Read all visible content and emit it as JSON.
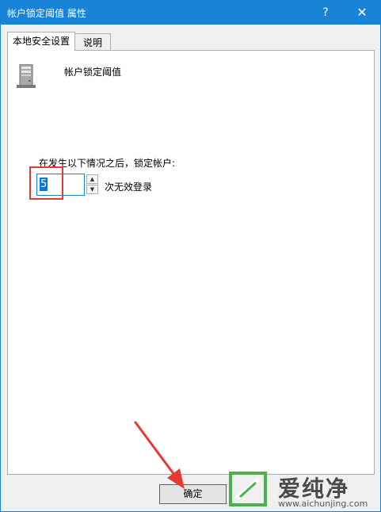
{
  "window": {
    "title": "帐户锁定阈值 属性",
    "help_label": "?",
    "close_label": "✕"
  },
  "tabs": [
    {
      "label": "本地安全设置",
      "active": true
    },
    {
      "label": "说明",
      "active": false
    }
  ],
  "policy": {
    "icon": "server-icon",
    "name": "帐户锁定阈值"
  },
  "setting": {
    "label": "在发生以下情况之后，锁定帐户:",
    "value": "5",
    "unit": "次无效登录",
    "spin_up_icon": "▲",
    "spin_down_icon": "▼"
  },
  "buttons": {
    "ok_label": "确定"
  },
  "annotation": {
    "highlight_color": "#e53935",
    "arrow_color": "#e53935"
  },
  "watermark": {
    "brand": "爱纯净",
    "url": "www.aichunjing.com",
    "color": "#4caf50"
  },
  "colors": {
    "accent": "#1883d7",
    "selection": "#0078d7"
  }
}
